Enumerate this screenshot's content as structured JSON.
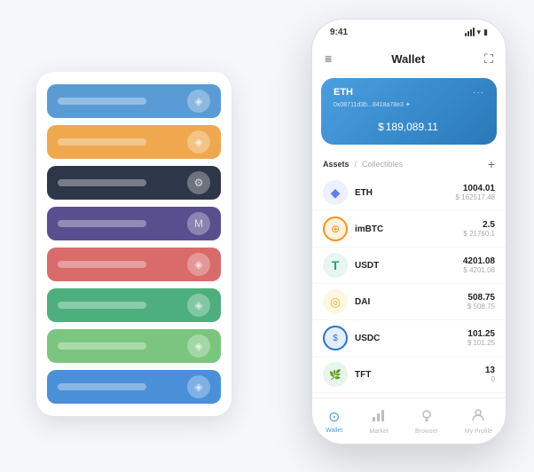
{
  "scene": {
    "background": "#f5f7fa"
  },
  "cardStack": {
    "cards": [
      {
        "color": "sc-blue",
        "icon": "◈"
      },
      {
        "color": "sc-orange",
        "icon": "◈"
      },
      {
        "color": "sc-dark",
        "icon": "⚙"
      },
      {
        "color": "sc-purple",
        "icon": "M"
      },
      {
        "color": "sc-red",
        "icon": "◈"
      },
      {
        "color": "sc-green",
        "icon": "◈"
      },
      {
        "color": "sc-lightgreen",
        "icon": "◈"
      },
      {
        "color": "sc-royalblue",
        "icon": "◈"
      }
    ]
  },
  "phone": {
    "statusBar": {
      "time": "9:41",
      "signal": "●●●",
      "wifi": "▾",
      "battery": "▮"
    },
    "navBar": {
      "menuIcon": "≡",
      "title": "Wallet",
      "expandIcon": "⛶"
    },
    "walletCard": {
      "coinLabel": "ETH",
      "address": "0x08711d3b...8418a78e3 ✦",
      "currencySymbol": "$",
      "amount": "189,089.11"
    },
    "assetsSection": {
      "tabActive": "Assets",
      "divider": "/",
      "tabInactive": "Collectibles",
      "addIcon": "+"
    },
    "assets": [
      {
        "name": "ETH",
        "icon": "◆",
        "iconColor": "#627eea",
        "amount": "1004.01",
        "usd": "$ 162517.48"
      },
      {
        "name": "imBTC",
        "icon": "⊕",
        "iconColor": "#f7931a",
        "amount": "2.5",
        "usd": "$ 21760.1"
      },
      {
        "name": "USDT",
        "icon": "T",
        "iconColor": "#26a17b",
        "amount": "4201.08",
        "usd": "$ 4201.08"
      },
      {
        "name": "DAI",
        "icon": "◎",
        "iconColor": "#f5ac37",
        "amount": "508.75",
        "usd": "$ 508.75"
      },
      {
        "name": "USDC",
        "icon": "$",
        "iconColor": "#2775ca",
        "amount": "101.25",
        "usd": "$ 101.25"
      },
      {
        "name": "TFT",
        "icon": "🌿",
        "iconColor": "#66bb6a",
        "amount": "13",
        "usd": "0"
      }
    ],
    "bottomNav": [
      {
        "label": "Wallet",
        "icon": "⊙",
        "active": true
      },
      {
        "label": "Market",
        "icon": "📊",
        "active": false
      },
      {
        "label": "Browser",
        "icon": "👤",
        "active": false
      },
      {
        "label": "My Profile",
        "icon": "👤",
        "active": false
      }
    ]
  }
}
